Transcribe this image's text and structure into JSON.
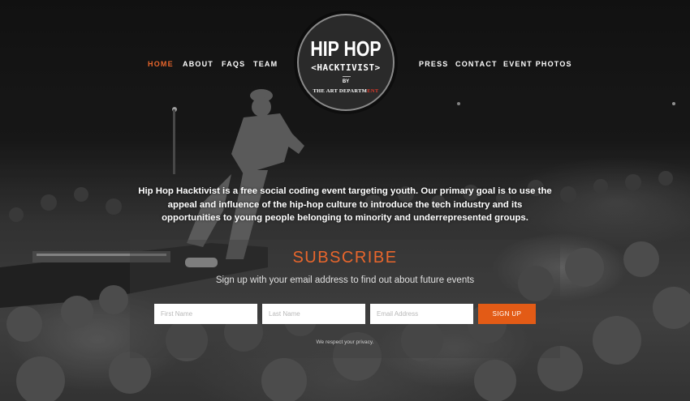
{
  "nav": {
    "left": [
      "HOME",
      "ABOUT",
      "FAQS",
      "TEAM"
    ],
    "right": [
      "PRESS",
      "CONTACT",
      "EVENT PHOTOS"
    ],
    "active": "HOME"
  },
  "logo": {
    "line1": "HIP HOP",
    "line2": "<HACKTIVIST>",
    "by": "BY",
    "org_main": "THE ART DEPARTM",
    "org_accent": "ENT"
  },
  "mission": "Hip Hop Hacktivist is a free social coding event targeting youth. Our primary goal is to use the appeal and influence of the hip-hop culture to introduce the tech industry and its opportunities to young people  belonging to minority and underrepresented groups.",
  "subscribe": {
    "title": "SUBSCRIBE",
    "subtitle": "Sign up with your email address to find out about future events",
    "first_name_placeholder": "First Name",
    "last_name_placeholder": "Last Name",
    "email_placeholder": "Email Address",
    "button": "SIGN UP",
    "privacy": "We respect your privacy."
  },
  "colors": {
    "accent": "#e9662c",
    "button": "#e35b16"
  },
  "background": "black-and-white concert photo of a crowd"
}
